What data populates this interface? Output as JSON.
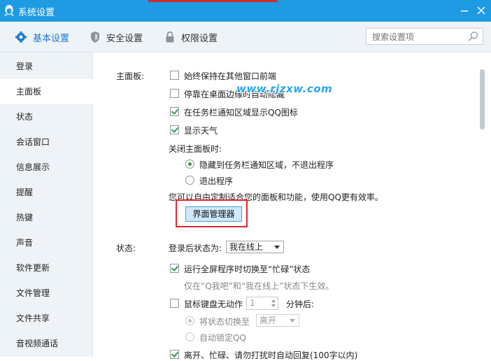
{
  "window": {
    "title": "系统设置"
  },
  "toolbar": {
    "tabs": [
      {
        "label": "基本设置"
      },
      {
        "label": "安全设置"
      },
      {
        "label": "权限设置"
      }
    ],
    "search_placeholder": "搜索设置项"
  },
  "sidebar": {
    "items": [
      {
        "label": "登录"
      },
      {
        "label": "主面板"
      },
      {
        "label": "状态"
      },
      {
        "label": "会话窗口"
      },
      {
        "label": "信息展示"
      },
      {
        "label": "提醒"
      },
      {
        "label": "热键"
      },
      {
        "label": "声音"
      },
      {
        "label": "软件更新"
      },
      {
        "label": "文件管理"
      },
      {
        "label": "文件共享"
      },
      {
        "label": "音视频通话"
      }
    ]
  },
  "main_panel": {
    "section_label": "主面板:",
    "options": [
      {
        "label": "始终保持在其他窗口前端",
        "checked": false
      },
      {
        "label": "停靠在桌面边缘时自动隐藏",
        "checked": false
      },
      {
        "label": "在任务栏通知区域显示QQ图标",
        "checked": true
      },
      {
        "label": "显示天气",
        "checked": true
      }
    ],
    "close_label": "关闭主面板时:",
    "close_options": [
      {
        "label": "隐藏到任务栏通知区域，不退出程序",
        "selected": true
      },
      {
        "label": "退出程序",
        "selected": false
      }
    ],
    "customize_text": "您可以自由定制适合您的面板和功能，使用QQ更有效率。",
    "manager_button": "界面管理器"
  },
  "watermark": "www.rjzxw.com",
  "status_panel": {
    "section_label": "状态:",
    "login_status_label": "登录后状态为:",
    "login_status_value": "我在线上",
    "fullscreen_label": "运行全屏程序时切换至“忙碌”状态",
    "fullscreen_note": "仅在“Q我吧”和“我在线上”状态下生效。",
    "idle_label_prefix": "鼠标键盘无动作",
    "idle_minutes": "1",
    "idle_label_suffix": "分钟后:",
    "switch_status_label": "将状态切换至",
    "switch_status_value": "离开",
    "auto_lock_label": "自动锁定QQ",
    "auto_reply_label": "离开、忙碌、请勿打扰时自动回复(100字以内)"
  }
}
